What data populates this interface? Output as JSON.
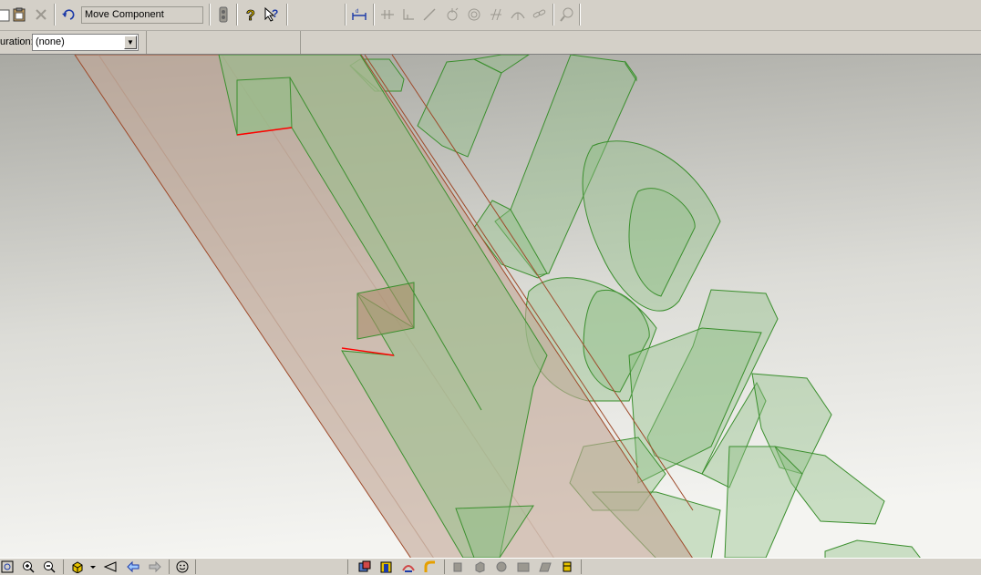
{
  "toolbar": {
    "command_value": "Move Component",
    "icons": [
      "paste-icon",
      "clipboard-icon",
      "delete-icon",
      "undo-icon",
      "traffic-light-icon",
      "help-icon",
      "whats-this-icon",
      "smart-dimension-icon",
      "add-relation-icon",
      "baseline-icon",
      "line-icon",
      "point-icon",
      "circle-icon",
      "parallel-icon",
      "arc-icon",
      "link-icon",
      "zoom-icon"
    ]
  },
  "config": {
    "label": "uration:",
    "value": "(none)"
  },
  "colors": {
    "viewport_top": "#a9a9a3",
    "viewport_bottom": "#f4f4f1",
    "part_fill": "#8fbf85",
    "part_edge": "#3b8f2e",
    "beam_fill": "#c4a898",
    "beam_edge": "#9e4a2a",
    "highlight_edge": "#ff0000"
  },
  "bottombar": {
    "icons": [
      "zoom-to-fit-icon",
      "zoom-in-icon",
      "zoom-out-icon",
      "view-orientation-icon",
      "previous-view-icon",
      "back-icon",
      "forward-icon",
      "face-icon",
      "shaded-view-icon",
      "wireframe-view-icon",
      "section-view-icon",
      "curvature-icon",
      "hidden-lines-icon",
      "display-icon",
      "shadow-icon",
      "perspective-icon",
      "realview-icon",
      "camera-icon"
    ]
  }
}
